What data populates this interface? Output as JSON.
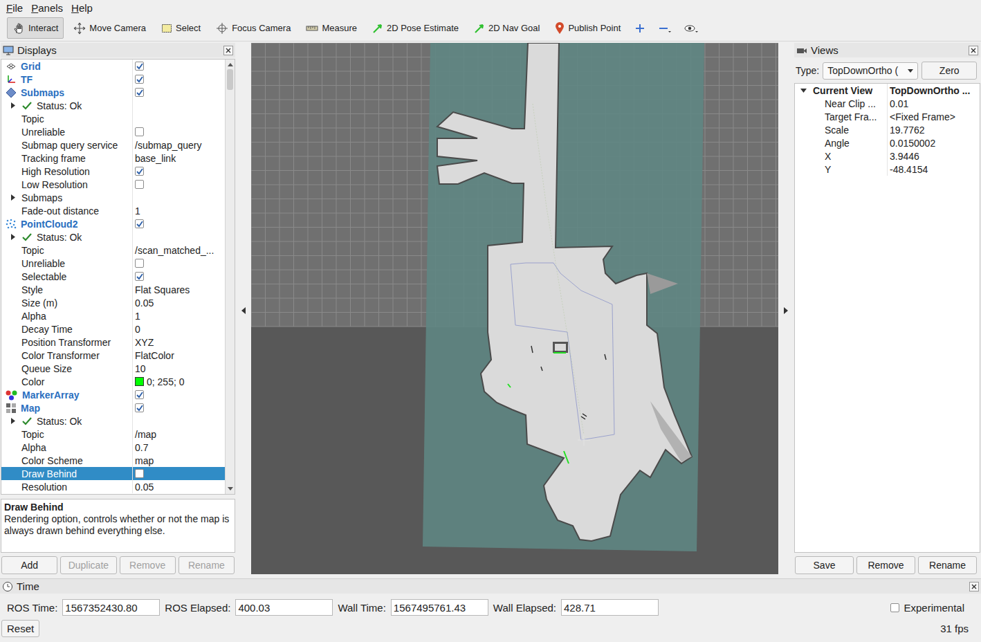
{
  "menu": [
    {
      "label": "File"
    },
    {
      "label": "Panels"
    },
    {
      "label": "Help"
    }
  ],
  "toolbar": [
    {
      "label": "Interact",
      "selected": true
    },
    {
      "label": "Move Camera",
      "selected": false
    },
    {
      "label": "Select",
      "selected": false
    },
    {
      "label": "Focus Camera",
      "selected": false
    },
    {
      "label": "Measure",
      "selected": false
    },
    {
      "label": "2D Pose Estimate",
      "selected": false
    },
    {
      "label": "2D Nav Goal",
      "selected": false
    },
    {
      "label": "Publish Point",
      "selected": false
    }
  ],
  "displays_panel": {
    "title": "Displays",
    "displays": [
      {
        "name": "Grid",
        "checked": true,
        "expanded": false,
        "selected": false,
        "children": []
      },
      {
        "name": "TF",
        "checked": true,
        "expanded": false,
        "selected": false,
        "children": []
      },
      {
        "name": "Submaps",
        "checked": true,
        "expanded": true,
        "selected": false,
        "children": [
          {
            "label": "Status: Ok",
            "kind": "status",
            "expanded": false,
            "selected": false
          },
          {
            "label": "Topic",
            "kind": "text",
            "value": "",
            "selected": false
          },
          {
            "label": "Unreliable",
            "kind": "check",
            "checked": false,
            "selected": false
          },
          {
            "label": "Submap query service",
            "kind": "text",
            "value": "/submap_query",
            "selected": false
          },
          {
            "label": "Tracking frame",
            "kind": "text",
            "value": "base_link",
            "selected": false
          },
          {
            "label": "High Resolution",
            "kind": "check",
            "checked": true,
            "selected": false
          },
          {
            "label": "Low Resolution",
            "kind": "check",
            "checked": false,
            "selected": false
          },
          {
            "label": "Submaps",
            "kind": "group",
            "expanded": false,
            "selected": false
          },
          {
            "label": "Fade-out distance",
            "kind": "text",
            "value": "1",
            "selected": false
          }
        ]
      },
      {
        "name": "PointCloud2",
        "checked": true,
        "expanded": true,
        "selected": false,
        "children": [
          {
            "label": "Status: Ok",
            "kind": "status",
            "expanded": false,
            "selected": false
          },
          {
            "label": "Topic",
            "kind": "text",
            "value": "/scan_matched_...",
            "selected": false
          },
          {
            "label": "Unreliable",
            "kind": "check",
            "checked": false,
            "selected": false
          },
          {
            "label": "Selectable",
            "kind": "check",
            "checked": true,
            "selected": false
          },
          {
            "label": "Style",
            "kind": "text",
            "value": "Flat Squares",
            "selected": false
          },
          {
            "label": "Size (m)",
            "kind": "text",
            "value": "0.05",
            "selected": false
          },
          {
            "label": "Alpha",
            "kind": "text",
            "value": "1",
            "selected": false
          },
          {
            "label": "Decay Time",
            "kind": "text",
            "value": "0",
            "selected": false
          },
          {
            "label": "Position Transformer",
            "kind": "text",
            "value": "XYZ",
            "selected": false
          },
          {
            "label": "Color Transformer",
            "kind": "text",
            "value": "FlatColor",
            "selected": false
          },
          {
            "label": "Queue Size",
            "kind": "text",
            "value": "10",
            "selected": false
          },
          {
            "label": "Color",
            "kind": "color",
            "value": "0; 255; 0",
            "color": "#00ff00",
            "selected": false
          }
        ]
      },
      {
        "name": "MarkerArray",
        "checked": true,
        "expanded": false,
        "selected": false,
        "children": []
      },
      {
        "name": "Map",
        "checked": true,
        "expanded": true,
        "selected": false,
        "children": [
          {
            "label": "Status: Ok",
            "kind": "status",
            "expanded": false,
            "selected": false
          },
          {
            "label": "Topic",
            "kind": "text",
            "value": "/map",
            "selected": false
          },
          {
            "label": "Alpha",
            "kind": "text",
            "value": "0.7",
            "selected": false
          },
          {
            "label": "Color Scheme",
            "kind": "text",
            "value": "map",
            "selected": false
          },
          {
            "label": "Draw Behind",
            "kind": "check",
            "checked": false,
            "selected": true
          },
          {
            "label": "Resolution",
            "kind": "text",
            "value": "0.05",
            "selected": false
          }
        ]
      }
    ],
    "description": {
      "title": "Draw Behind",
      "text": "Rendering option, controls whether or not the map is always drawn behind everything else."
    },
    "buttons": [
      {
        "label": "Add",
        "disabled": false
      },
      {
        "label": "Duplicate",
        "disabled": true
      },
      {
        "label": "Remove",
        "disabled": true
      },
      {
        "label": "Rename",
        "disabled": true
      }
    ]
  },
  "views_panel": {
    "title": "Views",
    "type_label": "Type:",
    "type_value": "TopDownOrtho (",
    "zero_button": "Zero",
    "tree": [
      {
        "label": "Current View",
        "value": "TopDownOrtho ...",
        "kind": "header",
        "expanded": true
      },
      {
        "label": "Near Clip ...",
        "value": "0.01",
        "kind": "prop"
      },
      {
        "label": "Target Fra...",
        "value": "<Fixed Frame>",
        "kind": "prop"
      },
      {
        "label": "Scale",
        "value": "19.7762",
        "kind": "prop"
      },
      {
        "label": "Angle",
        "value": "0.0150002",
        "kind": "prop"
      },
      {
        "label": "X",
        "value": "3.9446",
        "kind": "prop"
      },
      {
        "label": "Y",
        "value": "-48.4154",
        "kind": "prop"
      }
    ],
    "buttons": [
      "Save",
      "Remove",
      "Rename"
    ]
  },
  "time_panel": {
    "title": "Time",
    "fields": [
      {
        "label": "ROS Time:",
        "value": "1567352430.80"
      },
      {
        "label": "ROS Elapsed:",
        "value": "400.03"
      },
      {
        "label": "Wall Time:",
        "value": "1567495761.43"
      },
      {
        "label": "Wall Elapsed:",
        "value": "428.71"
      }
    ],
    "experimental": {
      "label": "Experimental",
      "checked": false
    },
    "reset_button": "Reset",
    "fps": "31 fps"
  }
}
